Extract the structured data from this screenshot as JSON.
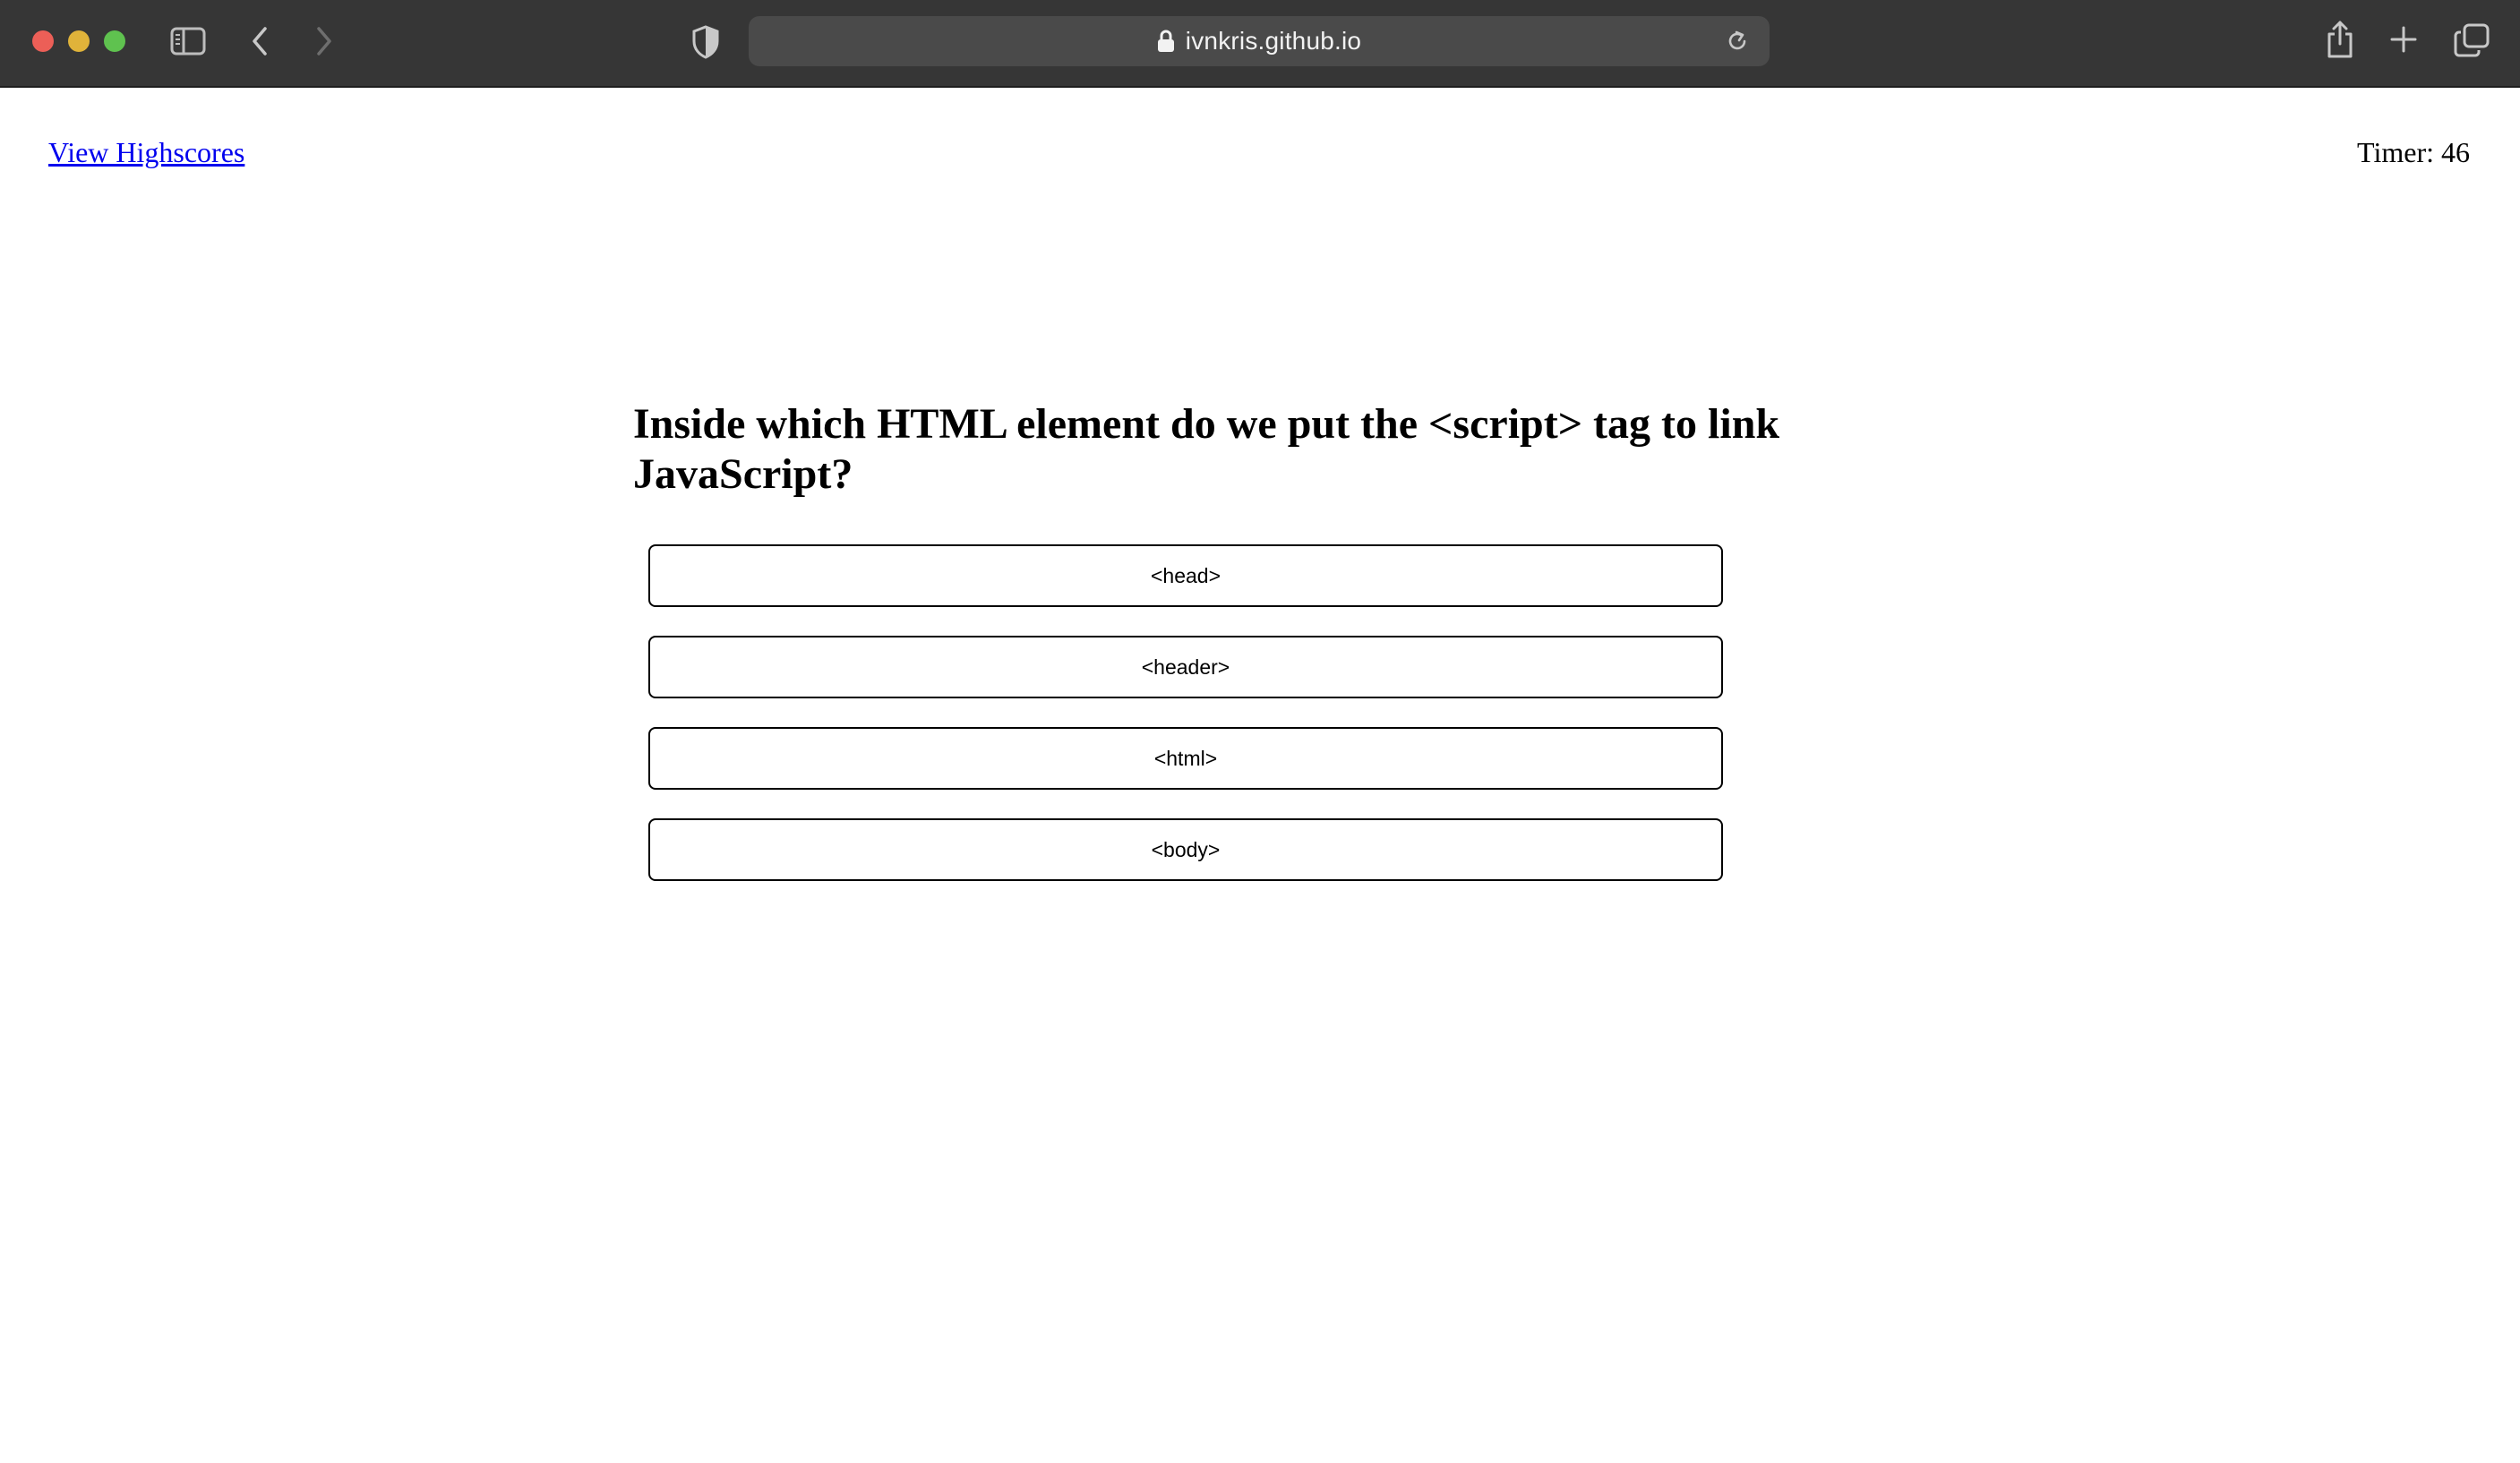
{
  "browser": {
    "url": "ivnkris.github.io",
    "icons": {
      "sidebar": "sidebar-icon",
      "back": "chevron-left-icon",
      "forward": "chevron-right-icon",
      "privacy": "shield-icon",
      "lock": "lock-icon",
      "reload": "reload-icon",
      "share": "share-icon",
      "new_tab": "plus-icon",
      "tabs": "tabs-overview-icon"
    },
    "colors": {
      "toolbar": "#363636",
      "address_bar": "#4a4a4a",
      "close": "#ec5f57",
      "minimize": "#e0b33a",
      "zoom": "#5fc24f"
    }
  },
  "page": {
    "highscores_link": "View Highscores",
    "timer": "Timer: 46",
    "question": "Inside which HTML element do we put the <script> tag to link JavaScript?",
    "answers": [
      "<head>",
      "<header>",
      "<html>",
      "<body>"
    ],
    "colors": {
      "link": "#0000ee",
      "text": "#000000",
      "background": "#ffffff"
    }
  }
}
